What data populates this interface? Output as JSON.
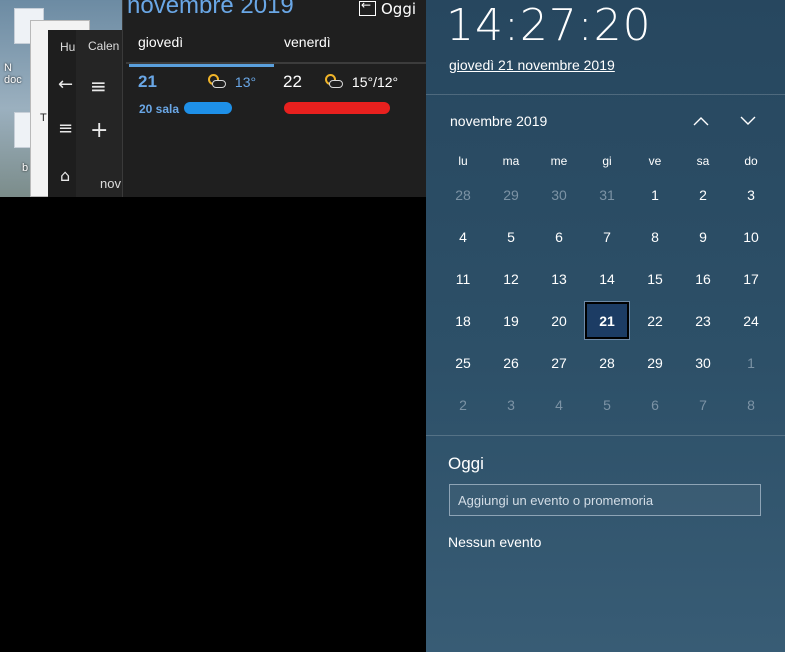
{
  "background": {
    "desktop_labels": [
      "N",
      "doc",
      "T",
      "b"
    ],
    "window1_title": "Hu",
    "window2_title": "Calen",
    "window2_bottom_text": "nov"
  },
  "calendar_app": {
    "title": "novembre 2019",
    "today_button": "Oggi",
    "days": [
      {
        "header": "giovedì",
        "number": "21",
        "temp": "13°",
        "event": "20 sala"
      },
      {
        "header": "venerdì",
        "number": "22",
        "temp": "15°/12°",
        "event": ""
      }
    ]
  },
  "flyout": {
    "time": "14:27:20",
    "date": "giovedì 21 novembre 2019",
    "month_label": "novembre 2019",
    "prev_icon": "chevron-up-icon",
    "next_icon": "chevron-down-icon",
    "weekdays": [
      "lu",
      "ma",
      "me",
      "gi",
      "ve",
      "sa",
      "do"
    ],
    "weeks": [
      [
        {
          "d": "28",
          "dim": true
        },
        {
          "d": "29",
          "dim": true
        },
        {
          "d": "30",
          "dim": true
        },
        {
          "d": "31",
          "dim": true
        },
        {
          "d": "1"
        },
        {
          "d": "2"
        },
        {
          "d": "3"
        }
      ],
      [
        {
          "d": "4"
        },
        {
          "d": "5"
        },
        {
          "d": "6"
        },
        {
          "d": "7"
        },
        {
          "d": "8"
        },
        {
          "d": "9"
        },
        {
          "d": "10"
        }
      ],
      [
        {
          "d": "11"
        },
        {
          "d": "12"
        },
        {
          "d": "13"
        },
        {
          "d": "14"
        },
        {
          "d": "15"
        },
        {
          "d": "16"
        },
        {
          "d": "17"
        }
      ],
      [
        {
          "d": "18"
        },
        {
          "d": "19"
        },
        {
          "d": "20"
        },
        {
          "d": "21",
          "today": true
        },
        {
          "d": "22"
        },
        {
          "d": "23"
        },
        {
          "d": "24"
        }
      ],
      [
        {
          "d": "25"
        },
        {
          "d": "26"
        },
        {
          "d": "27"
        },
        {
          "d": "28"
        },
        {
          "d": "29"
        },
        {
          "d": "30"
        },
        {
          "d": "1",
          "dim": true
        }
      ],
      [
        {
          "d": "2",
          "dim": true
        },
        {
          "d": "3",
          "dim": true
        },
        {
          "d": "4",
          "dim": true
        },
        {
          "d": "5",
          "dim": true
        },
        {
          "d": "6",
          "dim": true
        },
        {
          "d": "7",
          "dim": true
        },
        {
          "d": "8",
          "dim": true
        }
      ]
    ],
    "agenda_title": "Oggi",
    "event_placeholder": "Aggiungi un evento o promemoria",
    "no_events": "Nessun evento"
  },
  "colors": {
    "accent": "#6aa7e6",
    "flyout_bg": "#2d5068",
    "today_fill": "#1c3c64"
  }
}
